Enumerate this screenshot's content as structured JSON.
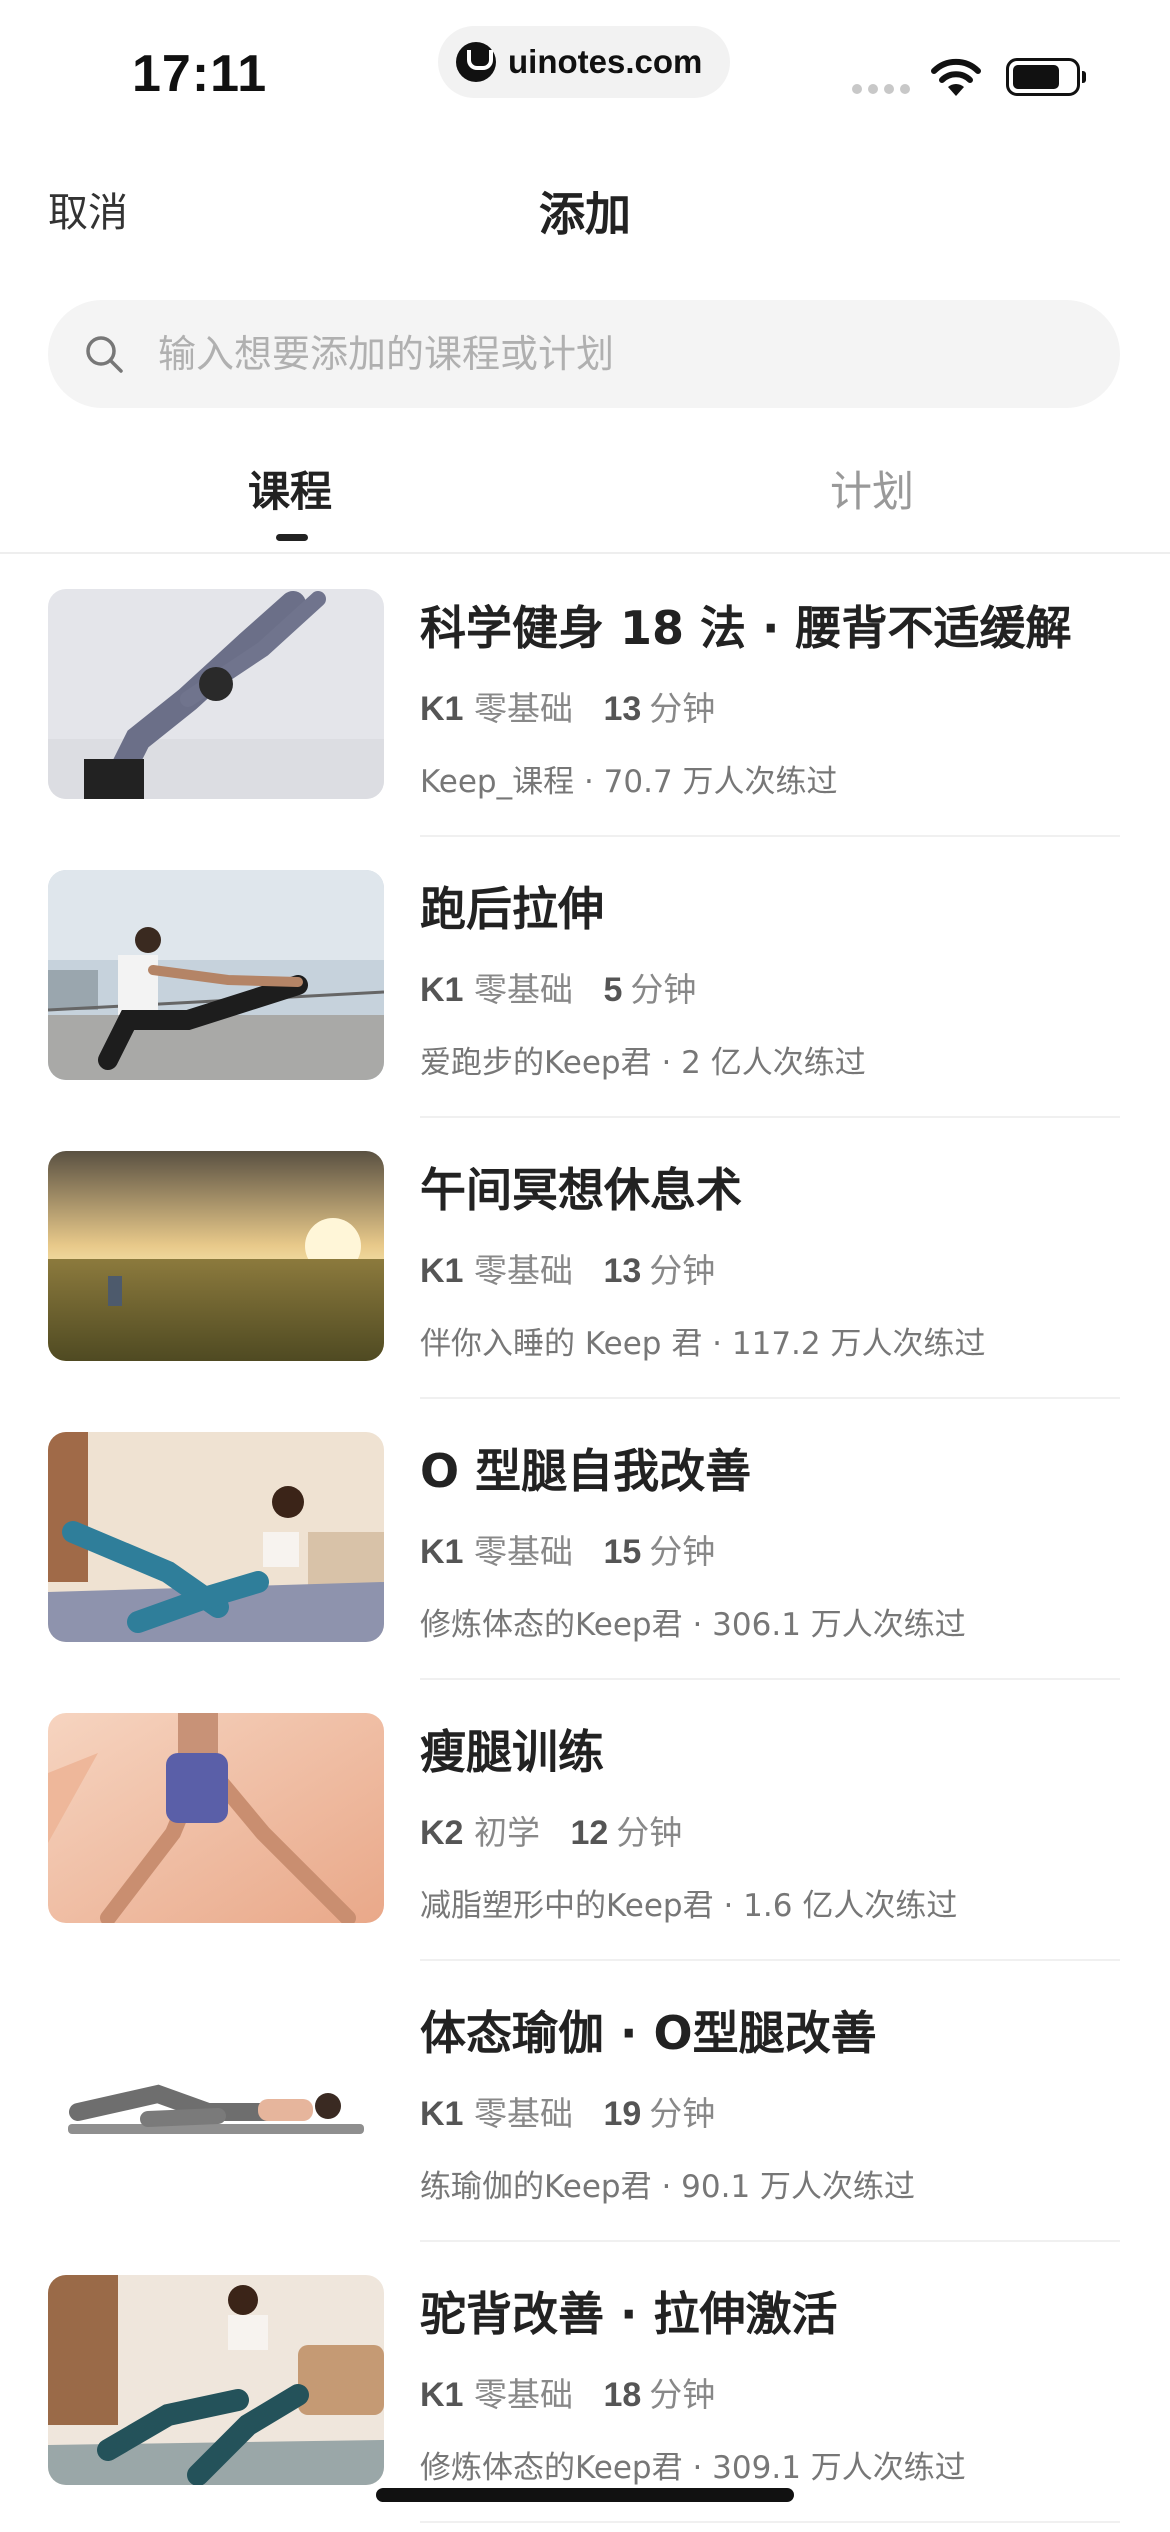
{
  "status": {
    "time": "17:11",
    "url": "uinotes.com"
  },
  "nav": {
    "cancel": "取消",
    "title": "添加"
  },
  "search": {
    "placeholder": "输入想要添加的课程或计划"
  },
  "tabs": [
    {
      "label": "课程",
      "active": true
    },
    {
      "label": "计划",
      "active": false
    }
  ],
  "courses": [
    {
      "title": "科学健身 18 法 · 腰背不适缓解",
      "level": "K1",
      "level_name": "零基础",
      "minutes": "13",
      "unit": "分钟",
      "info": "Keep_课程 · 70.7 万人次练过"
    },
    {
      "title": "跑后拉伸",
      "level": "K1",
      "level_name": "零基础",
      "minutes": "5",
      "unit": "分钟",
      "info": "爱跑步的Keep君 · 2 亿人次练过"
    },
    {
      "title": "午间冥想休息术",
      "level": "K1",
      "level_name": "零基础",
      "minutes": "13",
      "unit": "分钟",
      "info": "伴你入睡的 Keep 君 · 117.2 万人次练过"
    },
    {
      "title": "O 型腿自我改善",
      "level": "K1",
      "level_name": "零基础",
      "minutes": "15",
      "unit": "分钟",
      "info": "修炼体态的Keep君  · 306.1 万人次练过"
    },
    {
      "title": "瘦腿训练",
      "level": "K2",
      "level_name": "初学",
      "minutes": "12",
      "unit": "分钟",
      "info": "减脂塑形中的Keep君 · 1.6 亿人次练过"
    },
    {
      "title": "体态瑜伽 · O型腿改善",
      "level": "K1",
      "level_name": "零基础",
      "minutes": "19",
      "unit": "分钟",
      "info": "练瑜伽的Keep君 · 90.1 万人次练过"
    },
    {
      "title": "驼背改善 · 拉伸激活",
      "level": "K1",
      "level_name": "零基础",
      "minutes": "18",
      "unit": "分钟",
      "info": "修炼体态的Keep君  · 309.1 万人次练过"
    }
  ]
}
